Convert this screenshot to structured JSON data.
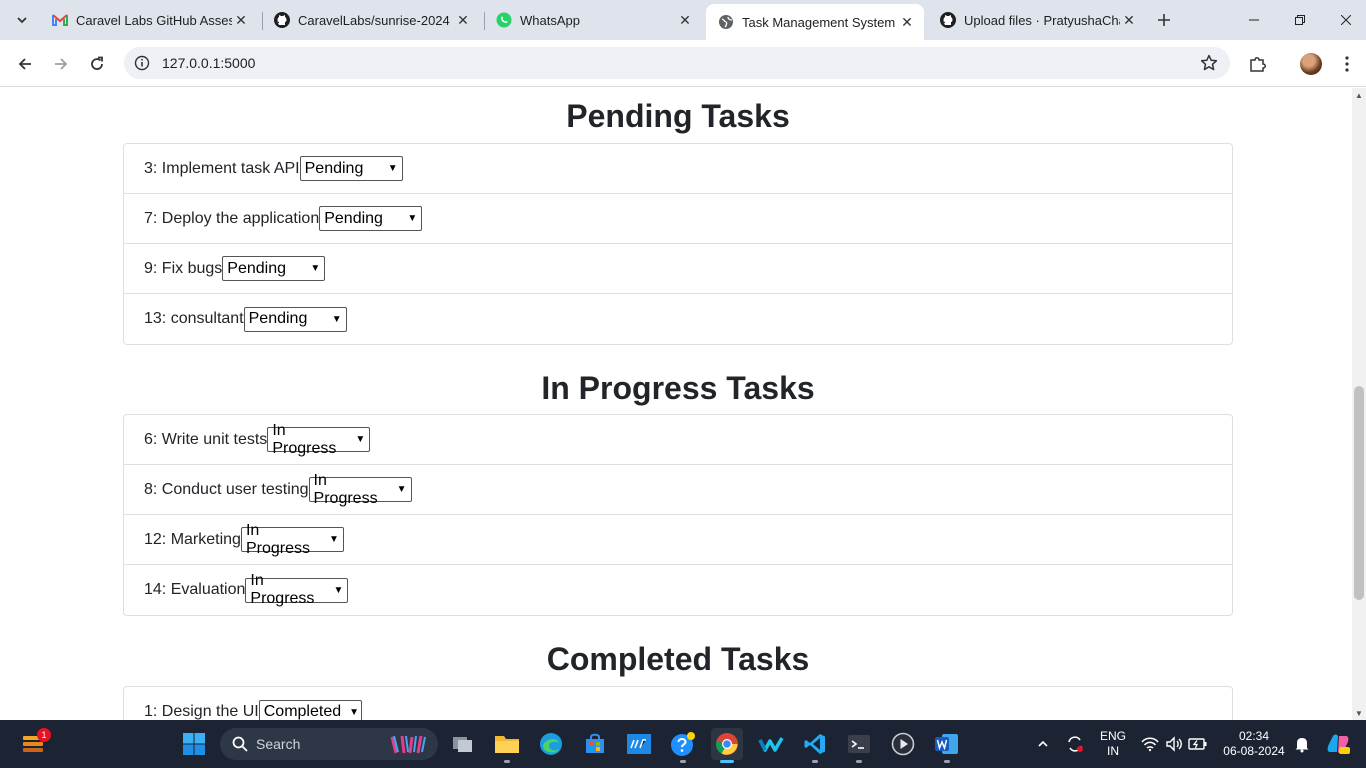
{
  "browser": {
    "tabs": [
      {
        "title": "Caravel Labs GitHub Assessm",
        "icon": "gmail-icon"
      },
      {
        "title": "CaravelLabs/sunrise-2024",
        "icon": "github-icon"
      },
      {
        "title": "WhatsApp",
        "icon": "whatsapp-icon"
      },
      {
        "title": "Task Management System",
        "icon": "globe-icon",
        "active": true
      },
      {
        "title": "Upload files · PratyushaChat",
        "icon": "github-icon"
      }
    ],
    "url": "127.0.0.1:5000"
  },
  "page": {
    "sections": [
      {
        "title": "Pending Tasks",
        "tasks": [
          {
            "label": "3: Implement task API",
            "status": "Pending"
          },
          {
            "label": "7: Deploy the application",
            "status": "Pending"
          },
          {
            "label": "9: Fix bugs",
            "status": "Pending"
          },
          {
            "label": "13: consultant",
            "status": "Pending"
          }
        ]
      },
      {
        "title": "In Progress Tasks",
        "tasks": [
          {
            "label": "6: Write unit tests",
            "status": "In Progress"
          },
          {
            "label": "8: Conduct user testing",
            "status": "In Progress"
          },
          {
            "label": "12: Marketing",
            "status": "In Progress"
          },
          {
            "label": "14: Evaluation",
            "status": "In Progress"
          }
        ]
      },
      {
        "title": "Completed Tasks",
        "tasks": [
          {
            "label": "1: Design the UI",
            "status": "Completed"
          }
        ]
      }
    ]
  },
  "taskbar": {
    "search_label": "Search",
    "language_line1": "ENG",
    "language_line2": "IN",
    "time": "02:34",
    "date": "06-08-2024",
    "notification_count": "1"
  }
}
